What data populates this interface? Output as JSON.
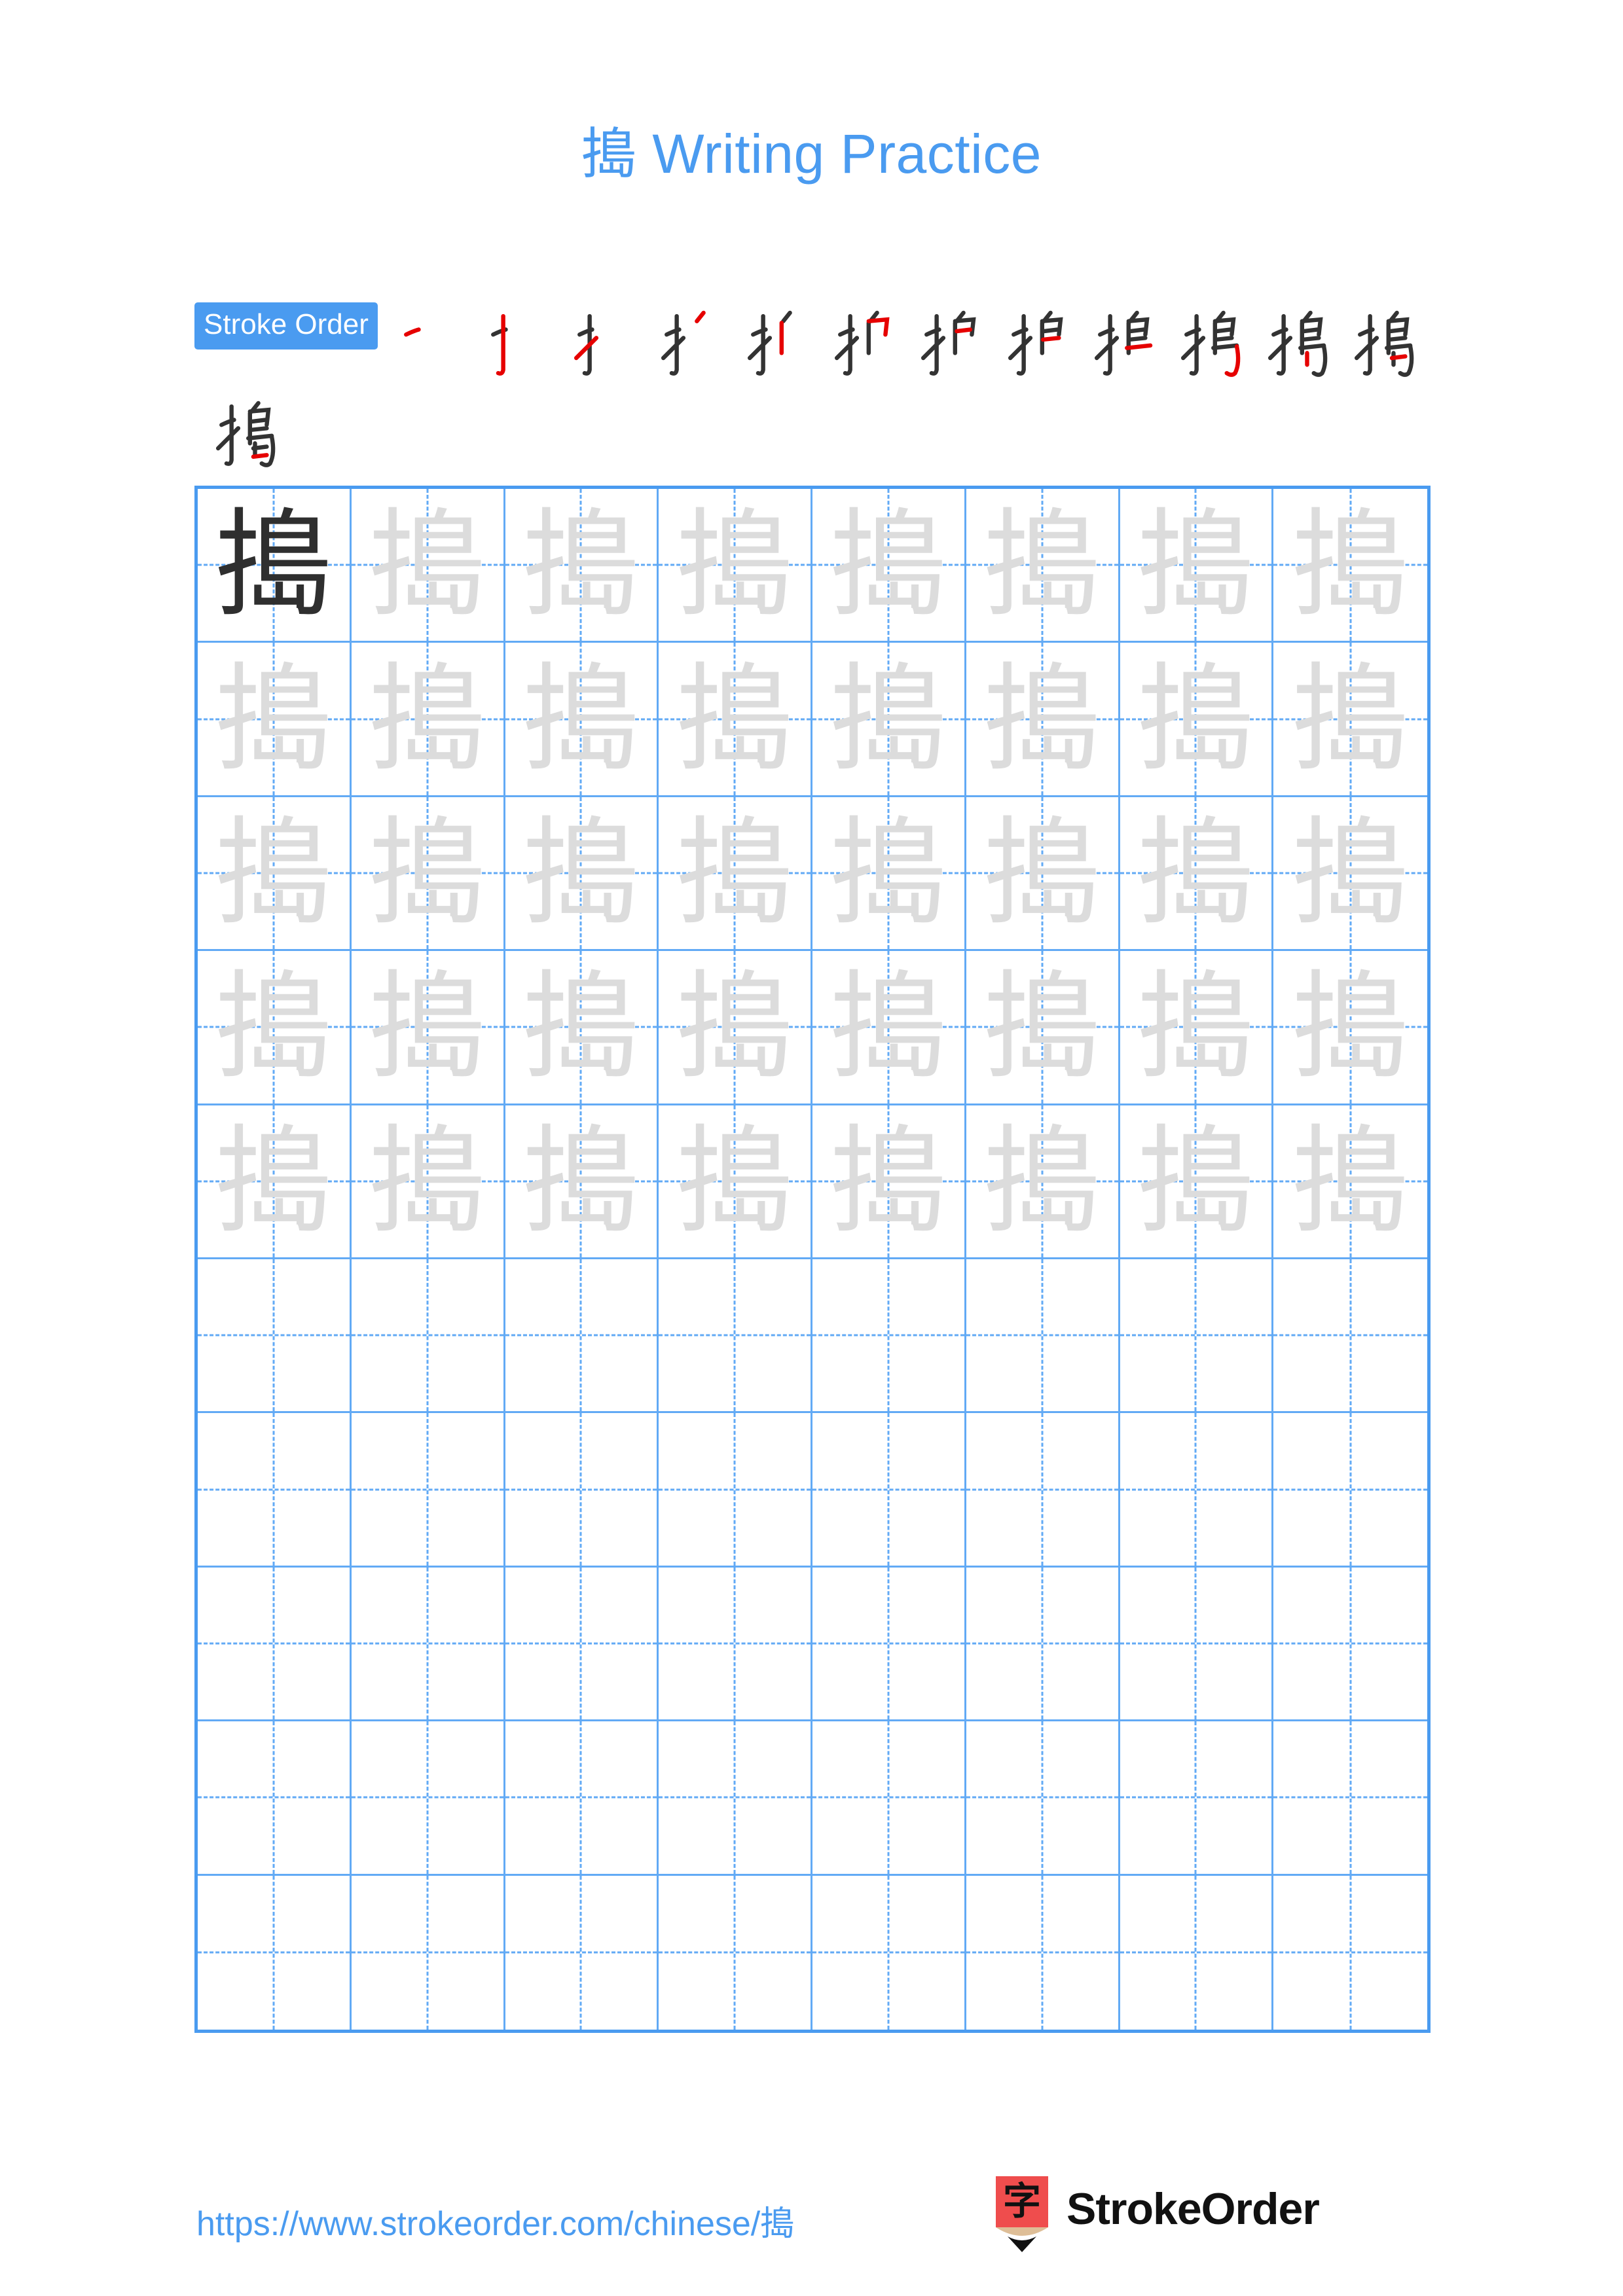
{
  "character": "搗",
  "title": {
    "character": "搗",
    "suffix": " Writing Practice",
    "full": "搗 Writing Practice",
    "color": "#4a9bf0"
  },
  "stroke_order": {
    "badge_label": "Stroke Order",
    "badge_bg": "#4a9bf0",
    "badge_text_color": "#ffffff",
    "total_strokes": 13,
    "new_stroke_color": "#e60000",
    "prior_stroke_color": "#333333",
    "row1_count": 12,
    "row2_count": 1,
    "steps": [
      {
        "index": 1,
        "partial": "一"
      },
      {
        "index": 2,
        "partial": "十"
      },
      {
        "index": 3,
        "partial": "扌"
      },
      {
        "index": 4,
        "partial": "扌丿"
      },
      {
        "index": 5,
        "partial": "扩"
      },
      {
        "index": 6,
        "partial": "护"
      },
      {
        "index": 7,
        "partial": "护"
      },
      {
        "index": 8,
        "partial": "担"
      },
      {
        "index": 9,
        "partial": "捍"
      },
      {
        "index": 10,
        "partial": "搗"
      },
      {
        "index": 11,
        "partial": "搗"
      },
      {
        "index": 12,
        "partial": "搗"
      },
      {
        "index": 13,
        "partial": "搗"
      }
    ]
  },
  "grid": {
    "columns": 8,
    "rows": 10,
    "line_color": "#4a9bf0",
    "inner_line_color": "#62aaf5",
    "solid_char_color": "#2f2f2f",
    "ghost_char_color": "#dcdcdc",
    "filled_rows": 5,
    "blank_rows": 5,
    "solid_cell": {
      "row": 1,
      "col": 1
    }
  },
  "footer": {
    "url": "https://www.strokeorder.com/chinese/搗",
    "url_color": "#4a9bf0",
    "brand_name": "StrokeOrder",
    "logo": {
      "glyph": "字",
      "body_color": "#ef4d4d",
      "wood_color": "#debe97",
      "tip_color": "#111111",
      "glyph_color": "#111111"
    }
  }
}
